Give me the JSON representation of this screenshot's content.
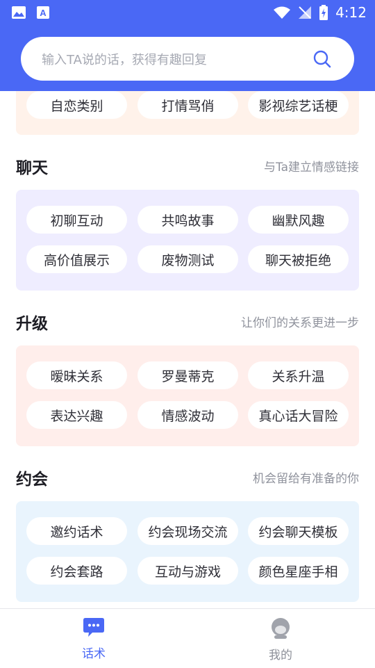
{
  "search": {
    "placeholder": "输入TA说的话，获得有趣回复"
  },
  "status": {
    "time": "4:12"
  },
  "top_chips": [
    "自恋类别",
    "打情骂俏",
    "影视综艺话梗"
  ],
  "sections": [
    {
      "title": "聊天",
      "subtitle": "与Ta建立情感链接",
      "chips": [
        "初聊互动",
        "共鸣故事",
        "幽默风趣",
        "高价值展示",
        "废物测试",
        "聊天被拒绝"
      ]
    },
    {
      "title": "升级",
      "subtitle": "让你们的关系更进一步",
      "chips": [
        "暧昧关系",
        "罗曼蒂克",
        "关系升温",
        "表达兴趣",
        "情感波动",
        "真心话大冒险"
      ]
    },
    {
      "title": "约会",
      "subtitle": "机会留给有准备的你",
      "chips": [
        "邀约话术",
        "约会现场交流",
        "约会聊天模板",
        "约会套路",
        "互动与游戏",
        "颜色星座手相"
      ]
    }
  ],
  "nav": {
    "tab1": "话术",
    "tab2": "我的"
  },
  "colors": {
    "header": "#4a68f5",
    "card_peach": "#fff2ea",
    "card_purple": "#efedff",
    "card_pink": "#ffeeeb",
    "card_blue": "#e9f4fd",
    "nav_active": "#4a68f5",
    "nav_inactive": "#8d9099"
  }
}
